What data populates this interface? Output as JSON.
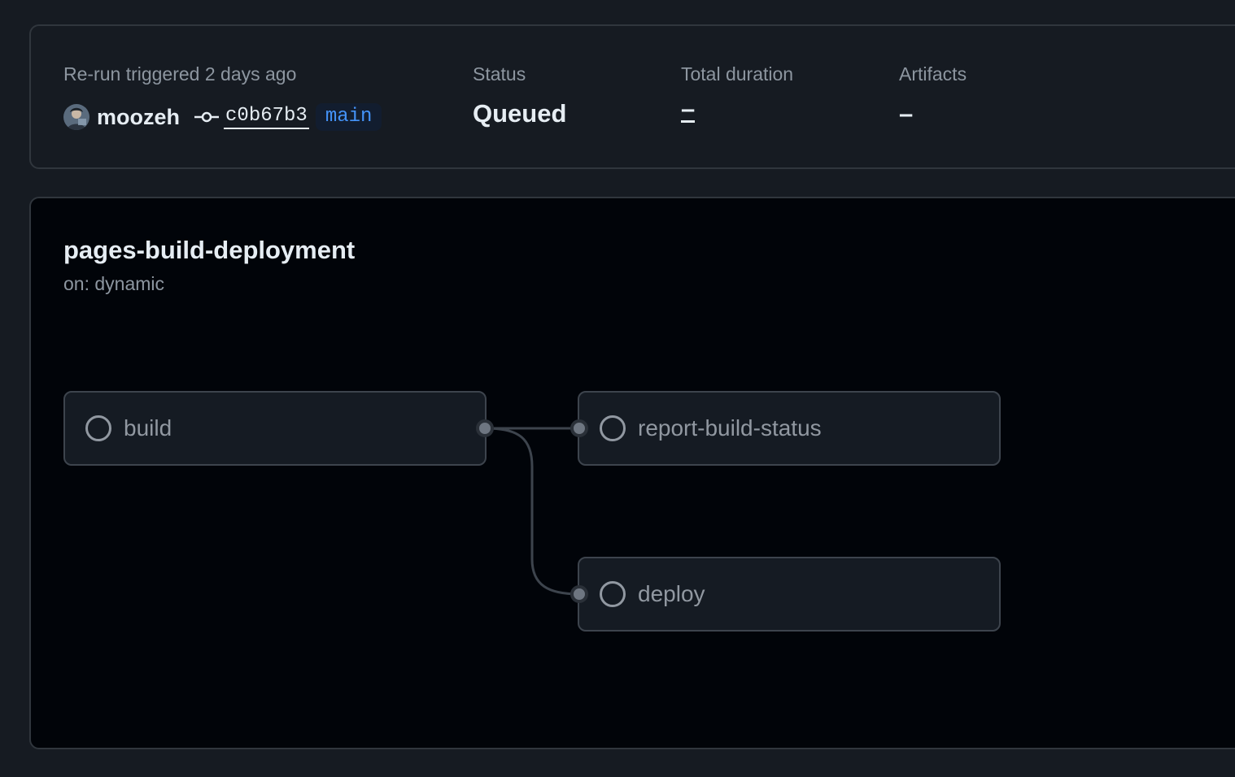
{
  "summary": {
    "trigger_label": "Re-run triggered 2 days ago",
    "username": "moozeh",
    "commit_sha": "c0b67b3",
    "branch": "main",
    "status_label": "Status",
    "status_value": "Queued",
    "duration_label": "Total duration",
    "duration_value": "–",
    "artifacts_label": "Artifacts",
    "artifacts_value": "–"
  },
  "workflow": {
    "title": "pages-build-deployment",
    "trigger": "on: dynamic",
    "jobs": [
      {
        "name": "build",
        "status": "queued",
        "icon": "circle-outline-icon"
      },
      {
        "name": "report-build-status",
        "status": "queued",
        "icon": "circle-outline-icon"
      },
      {
        "name": "deploy",
        "status": "queued",
        "icon": "circle-outline-icon"
      }
    ],
    "edges": [
      {
        "from": "build",
        "to": "report-build-status"
      },
      {
        "from": "build",
        "to": "deploy"
      }
    ]
  },
  "colors": {
    "page_bg": "#161b22",
    "graph_bg": "#010409",
    "border": "#30363d",
    "text_primary": "#e6edf3",
    "text_muted": "#8d96a0",
    "branch_accent": "#4493f8"
  },
  "icons": {
    "commit": "git-commit-icon",
    "job_status": "circle-outline-icon"
  }
}
